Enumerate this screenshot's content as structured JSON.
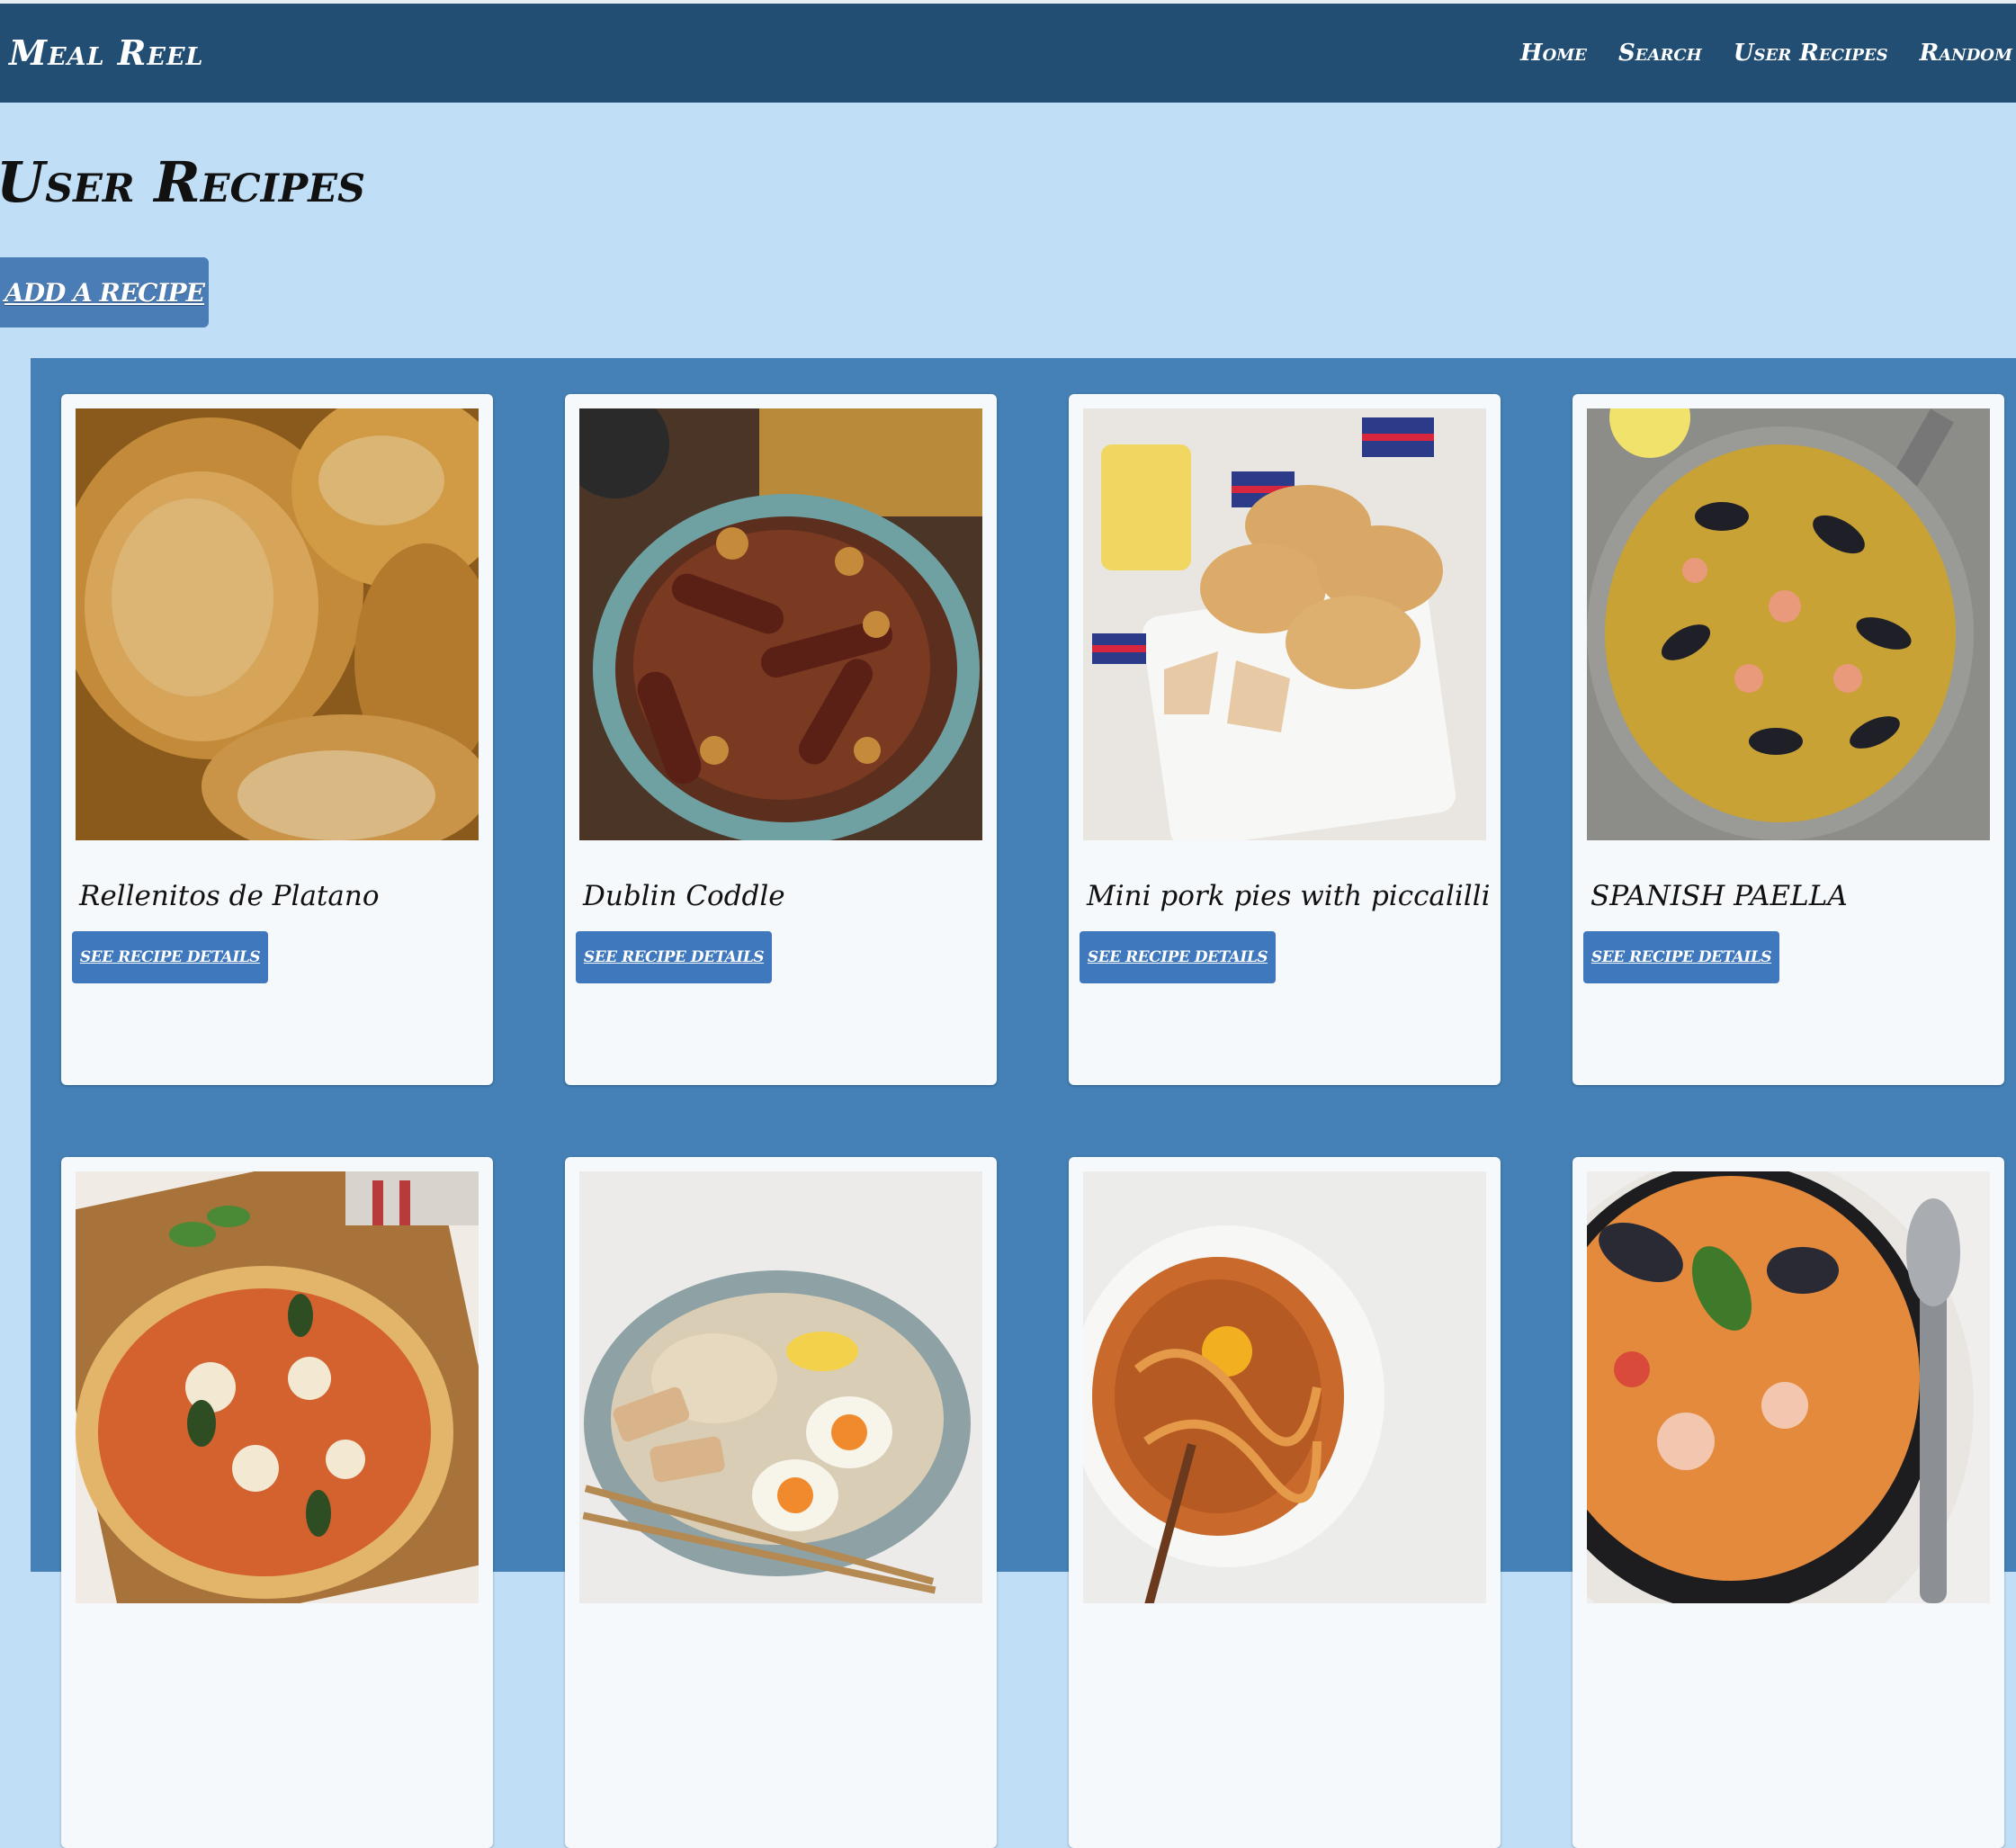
{
  "app": {
    "title": "Meal Reel"
  },
  "nav": {
    "items": [
      "Home",
      "Search",
      "User Recipes",
      "Random Recipe"
    ]
  },
  "page": {
    "title": "User Recipes",
    "add_button": "ADD A RECIPE"
  },
  "recipes": [
    {
      "title": "Rellenitos de Platano",
      "button": "SEE RECIPE DETAILS",
      "image_icon": "fried-plantain-photo"
    },
    {
      "title": "Dublin Coddle",
      "button": "SEE RECIPE DETAILS",
      "image_icon": "sausage-stew-photo"
    },
    {
      "title": "Mini pork pies with piccalilli",
      "button": "SEE RECIPE DETAILS",
      "image_icon": "pork-pies-photo"
    },
    {
      "title": "SPANISH PAELLA",
      "button": "SEE RECIPE DETAILS",
      "image_icon": "paella-photo"
    },
    {
      "title": "",
      "button": "",
      "image_icon": "pizza-photo"
    },
    {
      "title": "",
      "button": "",
      "image_icon": "ramen-photo"
    },
    {
      "title": "",
      "button": "",
      "image_icon": "noodles-photo"
    },
    {
      "title": "",
      "button": "",
      "image_icon": "seafood-soup-photo"
    }
  ],
  "colors": {
    "navbar": "#224e74",
    "page_background": "#c0def6",
    "grid_background": "#4580b6",
    "button": "#3f78bd",
    "card": "#f5f9fc"
  }
}
